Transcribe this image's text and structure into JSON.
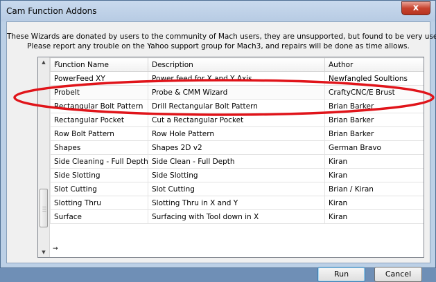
{
  "window": {
    "title": "Cam Function Addons",
    "close_glyph": "x"
  },
  "intro": {
    "line1": "These Wizards are donated by users to the community of Mach users, they are unsupported, but found to be very usefull.",
    "line2": "Please report any trouble on the Yahoo support group for Mach3, and repairs will be done as time allows."
  },
  "table": {
    "sort_indicator": "^",
    "columns": [
      "Function Name",
      "Description",
      "Author"
    ],
    "rows": [
      [
        "PowerFeed XY",
        "Power feed for X and Y Axis",
        "Newfangled Soultions"
      ],
      [
        "ProbeIt",
        "Probe & CMM  Wizard",
        "CraftyCNC/E Brust"
      ],
      [
        "Rectangular Bolt Pattern",
        "Drill Rectangular Bolt Pattern",
        "Brian Barker"
      ],
      [
        "Rectangular Pocket",
        "Cut a Rectangular Pocket",
        "Brian Barker"
      ],
      [
        "Row Bolt Pattern",
        "Row Hole Pattern",
        "Brian Barker"
      ],
      [
        "Shapes",
        "Shapes 2D v2",
        "German Bravo"
      ],
      [
        "Side Cleaning - Full Depth",
        "Side Clean - Full Depth",
        "Kiran"
      ],
      [
        "Side Slotting",
        "Side Slotting",
        "Kiran"
      ],
      [
        "Slot Cutting",
        "Slot Cutting",
        "Brian / Kiran"
      ],
      [
        "Slotting Thru",
        "Slotting Thru in X and Y",
        "Kiran"
      ],
      [
        "Surface",
        "Surfacing with Tool down in X",
        "Kiran"
      ]
    ],
    "current_row_marker": "→"
  },
  "buttons": {
    "run": "Run",
    "cancel": "Cancel"
  },
  "annotation": {
    "color": "#e0141a"
  }
}
